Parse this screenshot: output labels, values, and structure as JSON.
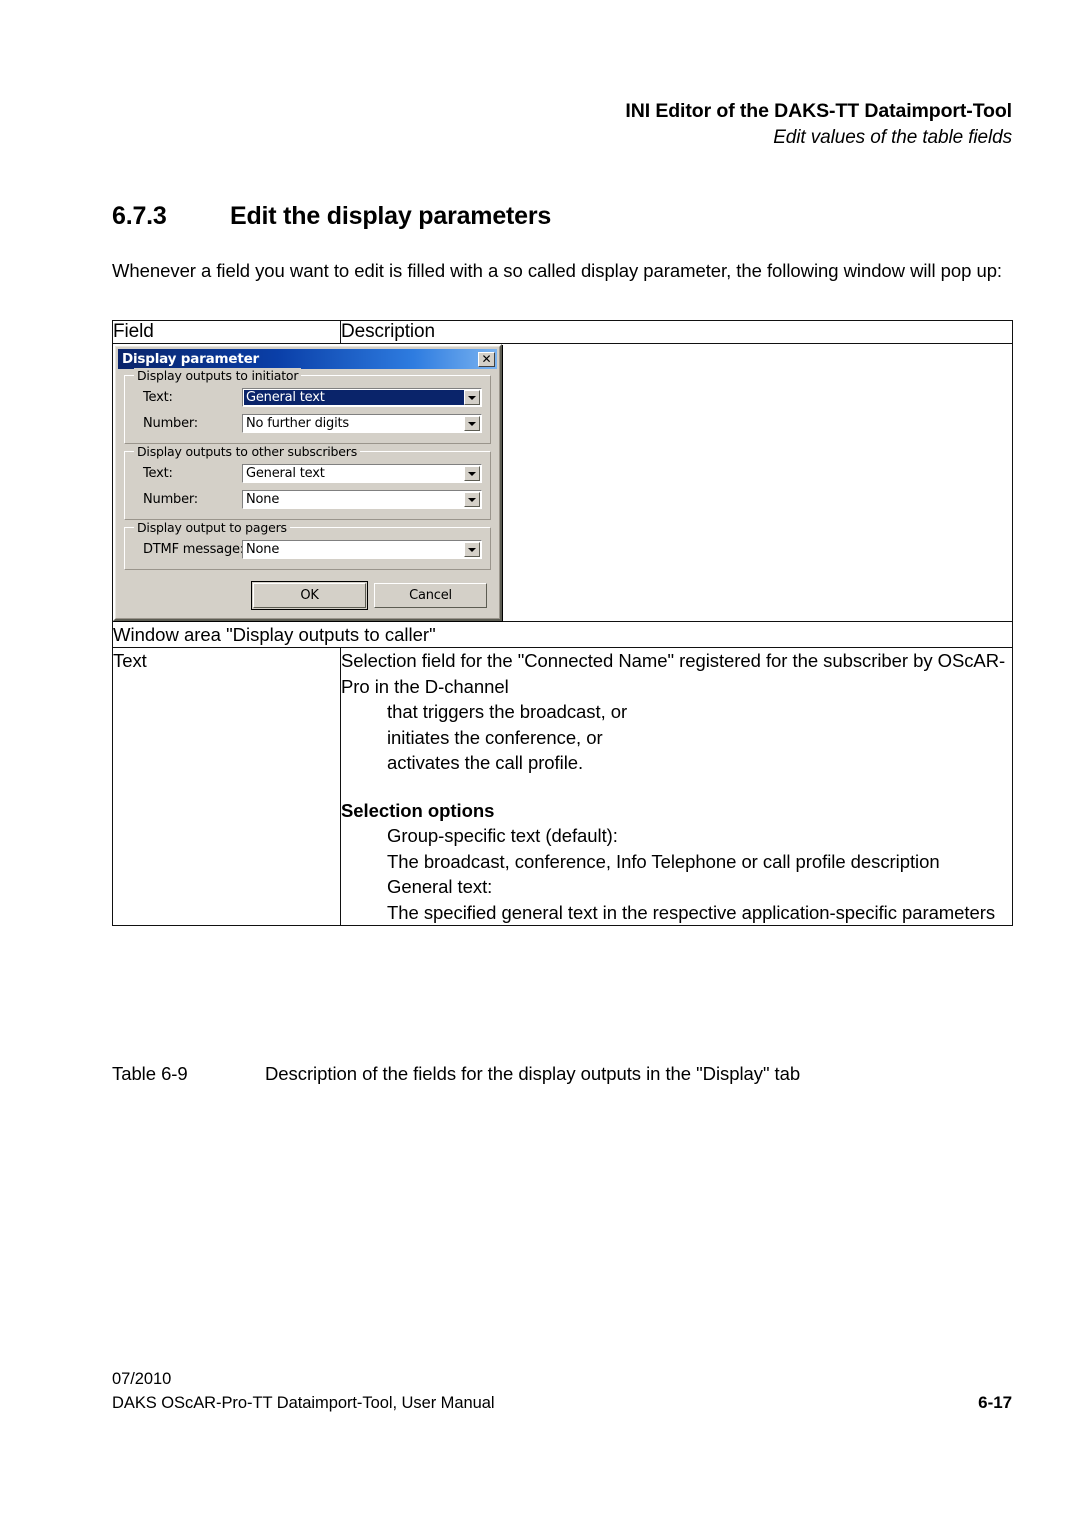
{
  "running_header": {
    "line1": "INI Editor of the DAKS-TT Dataimport-Tool",
    "line2": "Edit values of the table fields"
  },
  "section": {
    "number": "6.7.3",
    "title": "Edit the display parameters"
  },
  "intro_paragraph": "Whenever a field you want to edit is filled with a so called display parameter, the following window will pop up:",
  "table": {
    "headers": {
      "field": "Field",
      "description": "Description"
    },
    "window_area_row": "Window area \"Display outputs to caller\"",
    "rows": [
      {
        "field": "Text",
        "description_lines": [
          {
            "text": "Selection field for the \"Connected Name\" registered for the subscriber by OScAR-Pro in the D-channel",
            "style": "normal"
          },
          {
            "text": "that triggers the broadcast, or",
            "style": "indent"
          },
          {
            "text": "initiates the conference, or",
            "style": "indent"
          },
          {
            "text": "activates the call profile.",
            "style": "indent"
          },
          {
            "text": "Selection options",
            "style": "bold"
          },
          {
            "text": "Group-specific text (default):",
            "style": "indent"
          },
          {
            "text": "The broadcast, conference, Info Telephone or call profile description",
            "style": "indent"
          },
          {
            "text": "General text:",
            "style": "indent"
          },
          {
            "text": "The specified general text in the respective application-specific parameters",
            "style": "indent"
          }
        ]
      }
    ]
  },
  "table_caption": {
    "label": "Table 6-9",
    "text": "Description of the fields for the display outputs in the \"Display\" tab"
  },
  "footer": {
    "date": "07/2010",
    "manual": "DAKS OScAR-Pro-TT Dataimport-Tool, User Manual",
    "page": "6-17"
  },
  "dialog": {
    "title": "Display parameter",
    "close_label": "✕",
    "groups": [
      {
        "legend": "Display outputs to initiator",
        "fields": [
          {
            "label": "Text:",
            "value": "General text",
            "selected": true
          },
          {
            "label": "Number:",
            "value": "No further digits",
            "selected": false
          }
        ]
      },
      {
        "legend": "Display outputs to other subscribers",
        "fields": [
          {
            "label": "Text:",
            "value": "General text",
            "selected": false
          },
          {
            "label": "Number:",
            "value": "None",
            "selected": false
          }
        ]
      },
      {
        "legend": "Display output to pagers",
        "fields": [
          {
            "label": "DTMF message:",
            "value": "None",
            "selected": false
          }
        ]
      }
    ],
    "buttons": {
      "ok": "OK",
      "cancel": "Cancel"
    },
    "colors": {
      "titlebar_start": "#0a246a",
      "titlebar_end": "#7ab3f0",
      "dialog_face": "#d4d0c8",
      "selection": "#0a246a"
    }
  }
}
